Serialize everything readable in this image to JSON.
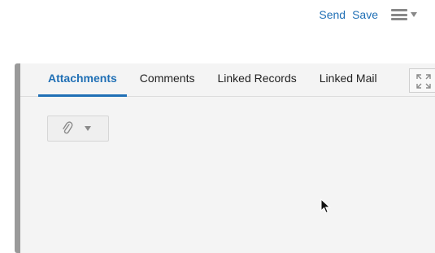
{
  "header": {
    "send_label": "Send",
    "save_label": "Save",
    "menu_icon": "hamburger-menu-icon"
  },
  "tabs": [
    {
      "label": "Attachments",
      "active": true
    },
    {
      "label": "Comments",
      "active": false
    },
    {
      "label": "Linked Records",
      "active": false
    },
    {
      "label": "Linked Mail",
      "active": false
    }
  ],
  "icons": {
    "expand": "expand-icon",
    "attach": "paperclip-icon",
    "dropdown": "chevron-down-icon",
    "cursor": "mouse-pointer-icon"
  },
  "colors": {
    "accent": "#1f6fb5",
    "panel_bg": "#f4f4f4",
    "panel_border": "#9a9a9a"
  }
}
